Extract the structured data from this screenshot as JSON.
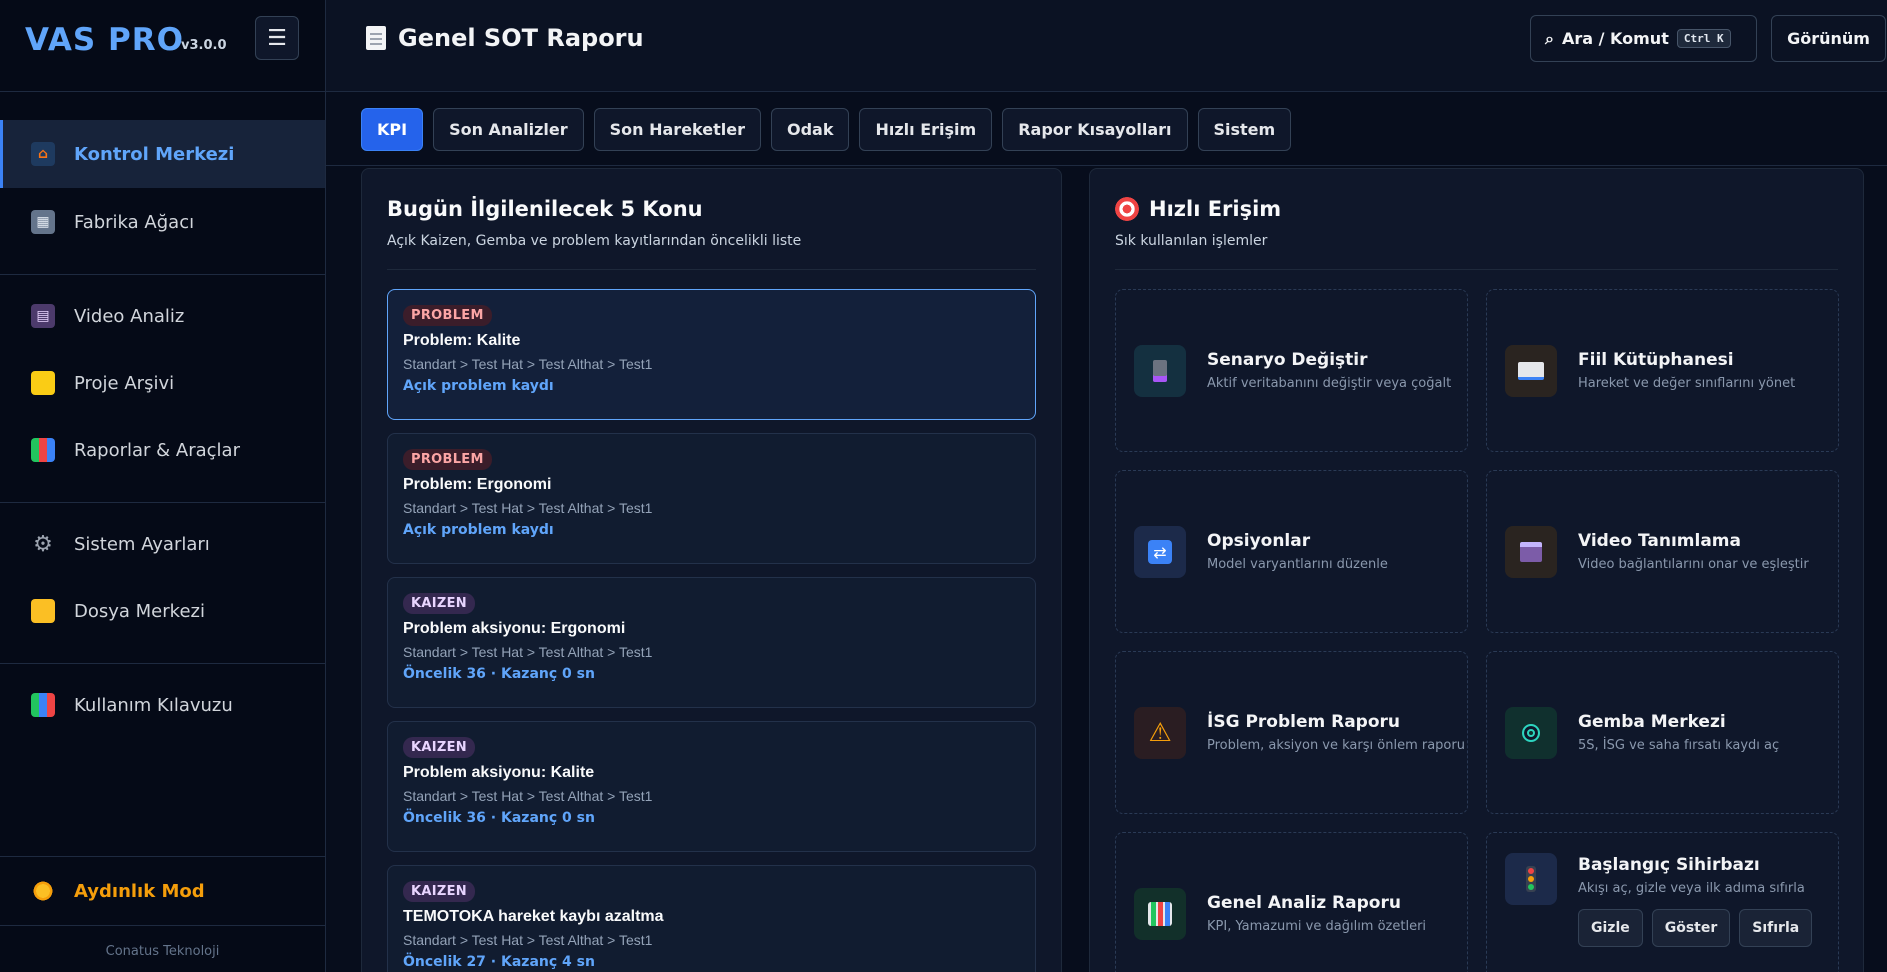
{
  "sidebar": {
    "brand": "VAS PRO",
    "version": "v3.0.0",
    "items": [
      {
        "label": "Kontrol Merkezi",
        "icon": "house-icon"
      },
      {
        "label": "Fabrika Ağacı",
        "icon": "building-icon"
      },
      {
        "label": "Video Analiz",
        "icon": "clapper-icon"
      },
      {
        "label": "Proje Arşivi",
        "icon": "folder-icon"
      },
      {
        "label": "Raporlar & Araçlar",
        "icon": "chart-icon"
      },
      {
        "label": "Sistem Ayarları",
        "icon": "gear-icon"
      },
      {
        "label": "Dosya Merkezi",
        "icon": "open-folder-icon"
      },
      {
        "label": "Kullanım Kılavuzu",
        "icon": "books-icon"
      }
    ],
    "light_mode": "Aydınlık Mod",
    "company": "Conatus Teknoloji"
  },
  "header": {
    "title": "Genel SOT Raporu",
    "search_label": "Ara / Komut",
    "search_shortcut": "Ctrl K",
    "view_label": "Görünüm"
  },
  "tabs": [
    "KPI",
    "Son Analizler",
    "Son Hareketler",
    "Odak",
    "Hızlı Erişim",
    "Rapor Kısayolları",
    "Sistem"
  ],
  "left_panel": {
    "title": "Bugün İlgilenilecek 5 Konu",
    "subtitle": "Açık Kaizen, Gemba ve problem kayıtlarından öncelikli liste",
    "items": [
      {
        "badge": "PROBLEM",
        "title": "Problem: Kalite",
        "path": "Standart > Test Hat > Test Althat > Test1",
        "meta": "Açık problem kaydı"
      },
      {
        "badge": "PROBLEM",
        "title": "Problem: Ergonomi",
        "path": "Standart > Test Hat > Test Althat > Test1",
        "meta": "Açık problem kaydı"
      },
      {
        "badge": "KAIZEN",
        "title": "Problem aksiyonu: Ergonomi",
        "path": "Standart > Test Hat > Test Althat > Test1",
        "meta": "Öncelik 36 · Kazanç 0 sn"
      },
      {
        "badge": "KAIZEN",
        "title": "Problem aksiyonu: Kalite",
        "path": "Standart > Test Hat > Test Althat > Test1",
        "meta": "Öncelik 36 · Kazanç 0 sn"
      },
      {
        "badge": "KAIZEN",
        "title": "TEMOTOKA hareket kaybı azaltma",
        "path": "Standart > Test Hat > Test Althat > Test1",
        "meta": "Öncelik 27 · Kazanç 4 sn"
      }
    ]
  },
  "right_panel": {
    "title": "Hızlı Erişim",
    "subtitle": "Sık kullanılan işlemler",
    "cards": [
      {
        "title": "Senaryo Değiştir",
        "desc": "Aktif veritabanını değiştir veya çoğalt",
        "icon": "database-icon"
      },
      {
        "title": "Fiil Kütüphanesi",
        "desc": "Hareket ve değer sınıflarını yönet",
        "icon": "book-icon"
      },
      {
        "title": "Opsiyonlar",
        "desc": "Model varyantlarını düzenle",
        "icon": "shuffle-icon"
      },
      {
        "title": "Video Tanımlama",
        "desc": "Video bağlantılarını onar ve eşleştir",
        "icon": "clapper-icon"
      },
      {
        "title": "İSG Problem Raporu",
        "desc": "Problem, aksiyon ve karşı önlem raporu",
        "icon": "warning-icon"
      },
      {
        "title": "Gemba Merkezi",
        "desc": "5S, İSG ve saha fırsatı kaydı aç",
        "icon": "target-ring-icon"
      },
      {
        "title": "Genel Analiz Raporu",
        "desc": "KPI, Yamazumi ve dağılım özetleri",
        "icon": "chart-icon"
      },
      {
        "title": "Başlangıç Sihirbazı",
        "desc": "Akışı aç, gizle veya ilk adıma sıfırla",
        "icon": "traffic-light-icon"
      }
    ],
    "wizard_buttons": [
      "Gizle",
      "Göster",
      "Sıfırla"
    ]
  }
}
